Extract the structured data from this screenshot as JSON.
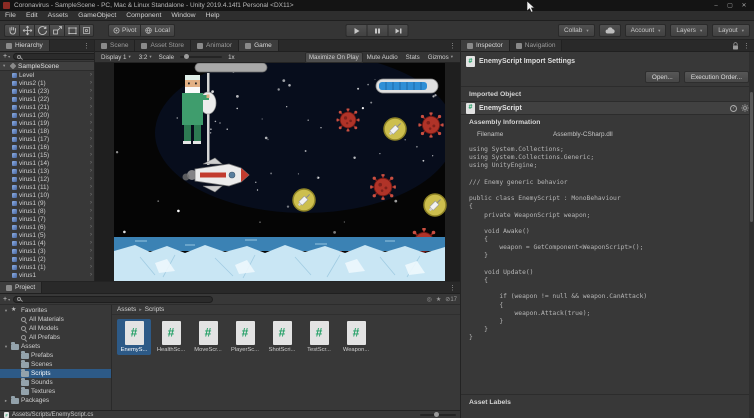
{
  "window": {
    "title": "Coronavirus - SampleScene - PC, Mac & Linux Standalone - Unity 2019.4.14f1 Personal <DX11>",
    "minimize": "–",
    "maximize": "▢",
    "close": "✕"
  },
  "menubar": {
    "items": [
      "File",
      "Edit",
      "Assets",
      "GameObject",
      "Component",
      "Window",
      "Help"
    ]
  },
  "toolbar": {
    "pivot": "Pivot",
    "local": "Local",
    "collab": "Collab",
    "account": "Account",
    "layers": "Layers",
    "layout": "Layout"
  },
  "hierarchy": {
    "tab": "Hierarchy",
    "scene": "SampleScene",
    "items": [
      "Level",
      "virus2 (1)",
      "virus1 (23)",
      "virus1 (22)",
      "virus1 (21)",
      "virus1 (20)",
      "virus1 (19)",
      "virus1 (18)",
      "virus1 (17)",
      "virus1 (16)",
      "virus1 (15)",
      "virus1 (14)",
      "virus1 (13)",
      "virus1 (12)",
      "virus1 (11)",
      "virus1 (10)",
      "virus1 (9)",
      "virus1 (8)",
      "virus1 (7)",
      "virus1 (6)",
      "virus1 (5)",
      "virus1 (4)",
      "virus1 (3)",
      "virus1 (2)",
      "virus1 (1)",
      "virus1"
    ]
  },
  "center": {
    "tabs": [
      {
        "label": "Scene"
      },
      {
        "label": "Asset Store"
      },
      {
        "label": "Animator"
      },
      {
        "label": "Game",
        "cls": "active"
      }
    ],
    "controls": {
      "display": "Display 1",
      "aspect": "3:2",
      "scale_label": "Scale",
      "scale_value": "1x",
      "buttons": [
        {
          "label": "Maximize On Play",
          "cls": "on"
        },
        {
          "label": "Mute Audio"
        },
        {
          "label": "Stats"
        },
        {
          "label": "Gizmos",
          "cls": "drop"
        }
      ]
    }
  },
  "project": {
    "tab": "Project",
    "hidden_count": "17",
    "tree": [
      {
        "label": "Favorites",
        "icon": "star",
        "arrow": "▾",
        "cls": "lvl0"
      },
      {
        "label": "All Materials",
        "icon": "search",
        "cls": "lvl1"
      },
      {
        "label": "All Models",
        "icon": "search",
        "cls": "lvl1"
      },
      {
        "label": "All Prefabs",
        "icon": "search",
        "cls": "lvl1"
      },
      {
        "label": "Assets",
        "icon": "folder",
        "arrow": "▾",
        "cls": "lvl0"
      },
      {
        "label": "Prefabs",
        "icon": "folder",
        "cls": "lvl1"
      },
      {
        "label": "Scenes",
        "icon": "folder",
        "cls": "lvl1"
      },
      {
        "label": "Scripts",
        "icon": "folder",
        "cls": "lvl1 selected"
      },
      {
        "label": "Sounds",
        "icon": "folder",
        "cls": "lvl1"
      },
      {
        "label": "Textures",
        "icon": "folder",
        "cls": "lvl1"
      },
      {
        "label": "Packages",
        "icon": "folder",
        "arrow": "▸",
        "cls": "lvl0"
      }
    ],
    "breadcrumb": [
      "Assets",
      "Scripts"
    ],
    "breadcrumb_sep": "▸",
    "files": [
      {
        "name": "EnemyS...",
        "cls": "selected"
      },
      {
        "name": "HealthSc..."
      },
      {
        "name": "MoveScr..."
      },
      {
        "name": "PlayerSc..."
      },
      {
        "name": "ShotScri..."
      },
      {
        "name": "TestScr..."
      },
      {
        "name": "Weapon..."
      }
    ],
    "status_path": "Assets/Scripts/EnemyScript.cs"
  },
  "inspector": {
    "tabs": [
      {
        "label": "Inspector",
        "cls": "active"
      },
      {
        "label": "Navigation"
      }
    ],
    "title": "EnemyScript Import Settings",
    "open_btn": "Open...",
    "exec_btn": "Execution Order...",
    "imported_object": "Imported Object",
    "script_name": "EnemyScript",
    "assembly_info": "Assembly Information",
    "filename_label": "Filename",
    "filename_value": "Assembly-CSharp.dll",
    "code": [
      "using System.Collections;",
      "using System.Collections.Generic;",
      "using UnityEngine;",
      "",
      "/// Enemy generic behavior",
      "",
      "public class EnemyScript : MonoBehaviour",
      "{",
      "    private WeaponScript weapon;",
      "",
      "    void Awake()",
      "    {",
      "        weapon = GetComponent<WeaponScript>();",
      "    }",
      "",
      "    void Update()",
      "    {",
      "",
      "        if (weapon != null && weapon.CanAttack)",
      "        {",
      "            weapon.Attack(true);",
      "        }",
      "    }",
      "}"
    ],
    "asset_labels": "Asset Labels"
  }
}
